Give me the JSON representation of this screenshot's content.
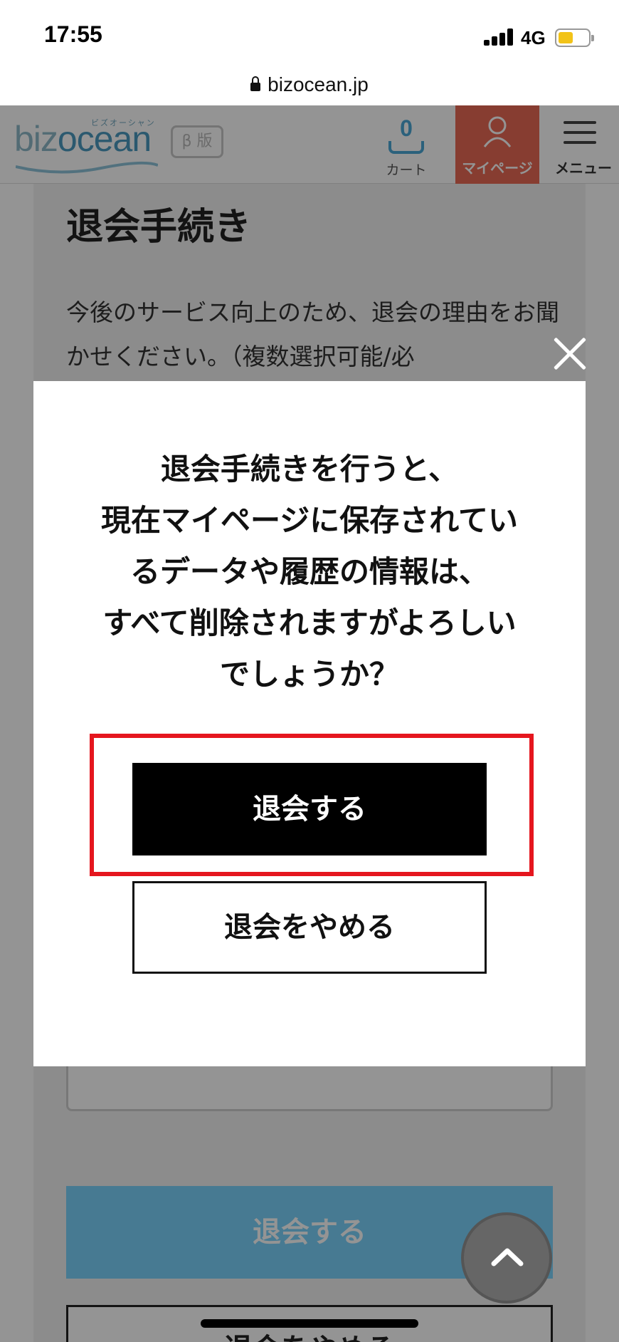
{
  "status_bar": {
    "time": "17:55",
    "network": "4G",
    "icons": [
      "signal-icon",
      "battery-icon"
    ],
    "battery_color": "#f2c318"
  },
  "browser": {
    "url": "bizocean.jp",
    "icon": "lock-icon"
  },
  "header": {
    "logo_text_a": "biz",
    "logo_text_b": "ocean",
    "logo_kana": "ビズオーシャン",
    "beta_badge": "β 版",
    "cart_count": "0",
    "cart_label": "カート",
    "mypage_label": "マイページ",
    "menu_label": "メニュー",
    "accent_color": "#e86a55",
    "brand_color": "#4a9ac0"
  },
  "page": {
    "title": "退会手続き",
    "description": "今後のサービス向上のため、退会の理由をお聞かせください。（複数選択可能/必",
    "submit_label": "退会する",
    "cancel_label": "退会をやめる",
    "submit_color": "#7ad3fb"
  },
  "modal": {
    "message_lines": [
      "退会手続きを行うと、",
      "現在マイページに保存されてい",
      "るデータや履歴の情報は、",
      "すべて削除されますがよろしい",
      "でしょうか？"
    ],
    "confirm_label": "退会する",
    "cancel_label": "退会をやめる",
    "highlight_color": "#e5161e",
    "close_icon": "close-icon"
  },
  "scroll_top_icon": "chevron-up-icon"
}
